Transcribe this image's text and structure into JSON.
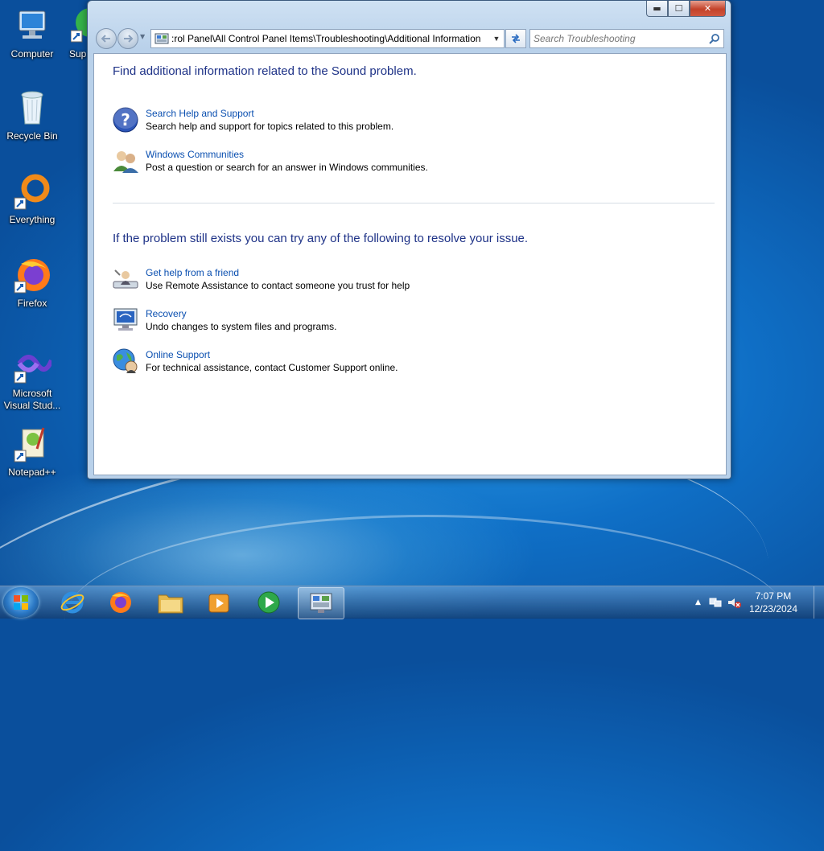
{
  "desktop": {
    "icons": [
      {
        "label": "Computer"
      },
      {
        "label": "Sup"
      },
      {
        "label": "Recycle Bin"
      },
      {
        "label": "Everything"
      },
      {
        "label": "Firefox"
      },
      {
        "label": "Microsoft Visual Stud..."
      },
      {
        "label": "Notepad++"
      }
    ]
  },
  "window": {
    "address_path": ":rol Panel\\All Control Panel Items\\Troubleshooting\\Additional Information",
    "search_placeholder": "Search Troubleshooting",
    "caption_buttons": {
      "minimize": "▬",
      "maximize": "☐",
      "close": "✕"
    },
    "section1": {
      "heading": "Find additional information related to the Sound problem.",
      "items": [
        {
          "link": "Search Help and Support",
          "desc": "Search help and support for topics related to this problem.",
          "icon": "help-question-icon"
        },
        {
          "link": "Windows Communities",
          "desc": "Post a question or search for an answer in Windows communities.",
          "icon": "community-users-icon"
        }
      ]
    },
    "section2": {
      "heading": "If the problem still exists you can try any of the following to resolve your issue.",
      "items": [
        {
          "link": "Get help from a friend",
          "desc": "Use Remote Assistance to contact someone you trust for help",
          "icon": "remote-assistance-icon"
        },
        {
          "link": "Recovery",
          "desc": "Undo changes to system files and programs.",
          "icon": "recovery-icon"
        },
        {
          "link": "Online Support",
          "desc": "For technical assistance, contact Customer Support online.",
          "icon": "online-support-globe-icon"
        }
      ]
    }
  },
  "taskbar": {
    "items": [
      "internet-explorer-icon",
      "firefox-icon",
      "file-explorer-icon",
      "media-player-icon",
      "media-center-icon",
      "control-panel-icon"
    ],
    "clock": {
      "time": "7:07 PM",
      "date": "12/23/2024"
    }
  }
}
